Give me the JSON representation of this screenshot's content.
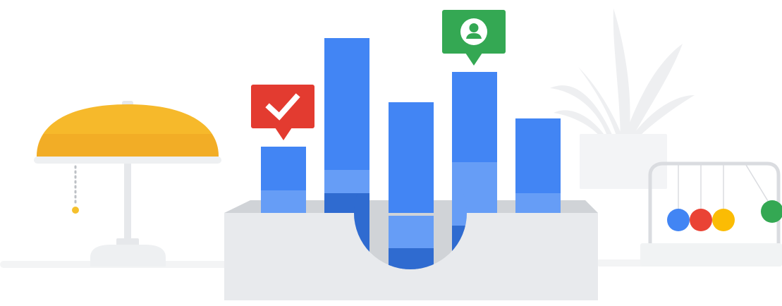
{
  "illustration": {
    "colors": {
      "background": "#ffffff",
      "lamp_shade": "#f6b92b",
      "lamp_shade_shadow": "#eea422",
      "lamp_base": "#eef0f2",
      "lamp_pole": "#e6e8eb",
      "pull_chain_bead": "#f5c02c",
      "pull_chain": "#bdc1c6",
      "floor_shadow": "#f3f4f5",
      "box_front": "#e8eaed",
      "box_inner": "#d0d3d7",
      "bar_blue": "#4285f4",
      "bar_light_blue": "#669df6",
      "bar_dark_blue": "#2f6bd0",
      "alert_red": "#e33b30",
      "alert_green": "#34a853",
      "plant_leaves": "#eeeff1",
      "plant_pot": "#f3f4f6",
      "cradle_frame": "#dadce0",
      "cradle_base": "#f1f3f4",
      "ball_blue": "#4285f4",
      "ball_red": "#ea4335",
      "ball_yellow": "#fbbc04",
      "ball_green": "#34a853"
    },
    "icons": {
      "red_callout": "checkmark-icon",
      "green_callout": "person-profile-icon"
    }
  }
}
